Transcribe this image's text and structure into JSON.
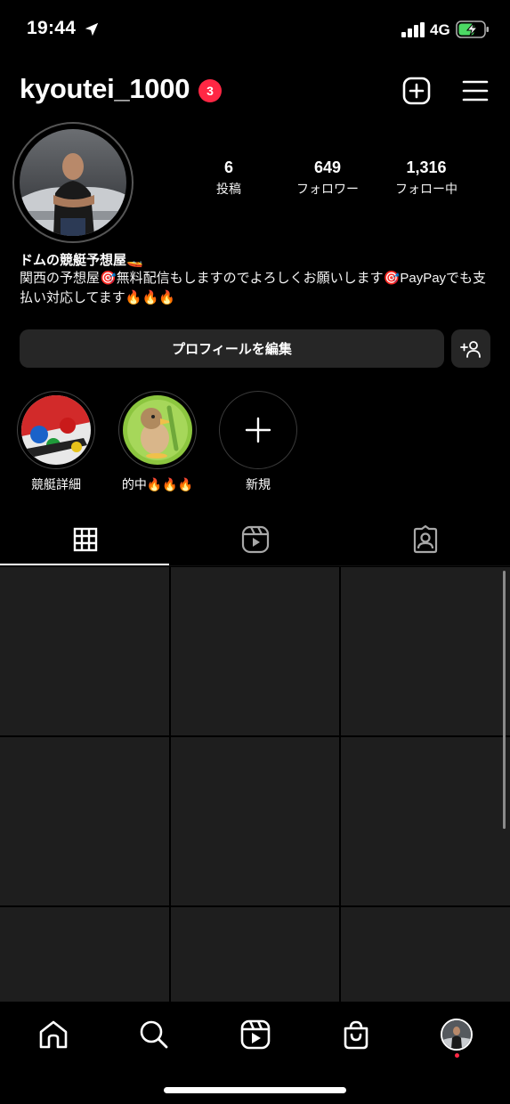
{
  "status_bar": {
    "time": "19:44",
    "network": "4G"
  },
  "header": {
    "username": "kyoutei_1000",
    "notification_count": "3"
  },
  "stats": {
    "posts": {
      "value": "6",
      "label": "投稿"
    },
    "followers": {
      "value": "649",
      "label": "フォロワー"
    },
    "following": {
      "value": "1,316",
      "label": "フォロー中"
    }
  },
  "bio": {
    "name": "ドムの競艇予想屋🚤",
    "text": "関西の予想屋🎯無料配信もしますのでよろしくお願いします🎯PayPayでも支払い対応してます🔥🔥🔥"
  },
  "buttons": {
    "edit_profile": "プロフィールを編集"
  },
  "highlights": [
    {
      "label": "競艇詳細"
    },
    {
      "label": "的中🔥🔥🔥"
    },
    {
      "label": "新規"
    }
  ],
  "colors": {
    "background": "#000000",
    "badge": "#ff2744",
    "button": "#262626",
    "grid_cell": "#1e1e1e"
  }
}
